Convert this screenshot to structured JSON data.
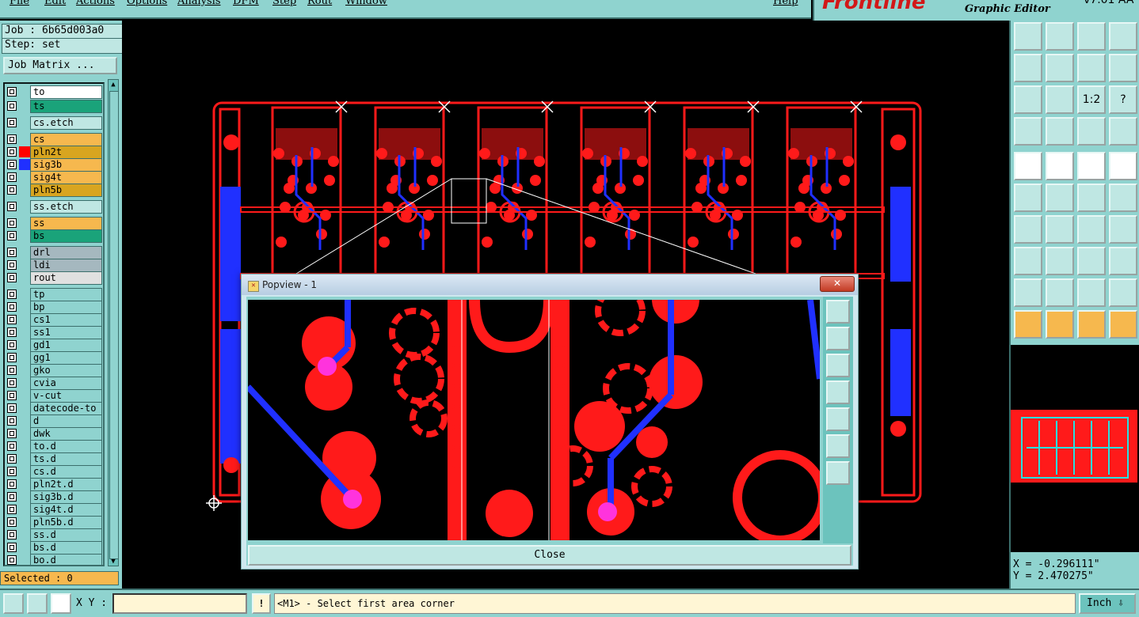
{
  "menubar": {
    "items": [
      "File",
      "Edit",
      "Actions",
      "Options",
      "Analysis",
      "DFM",
      "Step",
      "Rout",
      "Window"
    ],
    "help": "Help"
  },
  "brand": {
    "logo": "Frontline",
    "subtitle": "Graphic Editor",
    "version": "v7.01 AA"
  },
  "job": {
    "job_line": "Job : 6b65d003a0",
    "step_line": "Step: set",
    "matrix_button": "Job Matrix ..."
  },
  "layers": [
    {
      "name": "to",
      "color": "#ffffff",
      "swatch": ""
    },
    {
      "name": "ts",
      "color": "#1aa37a",
      "swatch": ""
    },
    {
      "name": "cs.etch",
      "color": "#bfe7e3",
      "swatch": ""
    },
    {
      "name": "cs",
      "color": "#f6b84e",
      "swatch": ""
    },
    {
      "name": "pln2t",
      "color": "#d8a520",
      "swatch": "#ff0000"
    },
    {
      "name": "sig3b",
      "color": "#f6b84e",
      "swatch": "#2030ff"
    },
    {
      "name": "sig4t",
      "color": "#f6b84e",
      "swatch": ""
    },
    {
      "name": "pln5b",
      "color": "#d8a520",
      "swatch": ""
    },
    {
      "name": "ss.etch",
      "color": "#bfe7e3",
      "swatch": ""
    },
    {
      "name": "ss",
      "color": "#f6b84e",
      "swatch": ""
    },
    {
      "name": "bs",
      "color": "#1aa37a",
      "swatch": ""
    },
    {
      "name": "drl",
      "color": "#a5b8bf",
      "swatch": ""
    },
    {
      "name": "ldi",
      "color": "#a5b8bf",
      "swatch": ""
    },
    {
      "name": "rout",
      "color": "#e0e0e0",
      "swatch": ""
    },
    {
      "name": "tp",
      "color": "#8fd3cf",
      "swatch": ""
    },
    {
      "name": "bp",
      "color": "#8fd3cf",
      "swatch": ""
    },
    {
      "name": "cs1",
      "color": "#8fd3cf",
      "swatch": ""
    },
    {
      "name": "ss1",
      "color": "#8fd3cf",
      "swatch": ""
    },
    {
      "name": "gd1",
      "color": "#8fd3cf",
      "swatch": ""
    },
    {
      "name": "gg1",
      "color": "#8fd3cf",
      "swatch": ""
    },
    {
      "name": "gko",
      "color": "#8fd3cf",
      "swatch": ""
    },
    {
      "name": "cvia",
      "color": "#8fd3cf",
      "swatch": ""
    },
    {
      "name": "v-cut",
      "color": "#8fd3cf",
      "swatch": ""
    },
    {
      "name": "datecode-to",
      "color": "#8fd3cf",
      "swatch": ""
    },
    {
      "name": "d",
      "color": "#8fd3cf",
      "swatch": ""
    },
    {
      "name": "dwk",
      "color": "#8fd3cf",
      "swatch": ""
    },
    {
      "name": "to.d",
      "color": "#8fd3cf",
      "swatch": ""
    },
    {
      "name": "ts.d",
      "color": "#8fd3cf",
      "swatch": ""
    },
    {
      "name": "cs.d",
      "color": "#8fd3cf",
      "swatch": ""
    },
    {
      "name": "pln2t.d",
      "color": "#8fd3cf",
      "swatch": ""
    },
    {
      "name": "sig3b.d",
      "color": "#8fd3cf",
      "swatch": ""
    },
    {
      "name": "sig4t.d",
      "color": "#8fd3cf",
      "swatch": ""
    },
    {
      "name": "pln5b.d",
      "color": "#8fd3cf",
      "swatch": ""
    },
    {
      "name": "ss.d",
      "color": "#8fd3cf",
      "swatch": ""
    },
    {
      "name": "bs.d",
      "color": "#8fd3cf",
      "swatch": ""
    },
    {
      "name": "bo.d",
      "color": "#8fd3cf",
      "swatch": ""
    }
  ],
  "status": {
    "selected": "Selected : 0"
  },
  "coords": {
    "x": "X = -0.296111\"",
    "y": "Y = 2.470275\""
  },
  "bottom": {
    "xy_label": "X Y :",
    "xy_value": "",
    "prompt": "<M1> - Select first area corner",
    "units": "Inch",
    "excl": "!"
  },
  "popview": {
    "title": "Popview - 1",
    "close_x": "✕",
    "close_button": "Close"
  },
  "toolbar_labels": {
    "ratio": "1:2",
    "help": "?"
  },
  "colors": {
    "panel": "#8fd3cf",
    "copper": "#ff0000",
    "signal": "#2030ff",
    "via": "#ff33dd"
  }
}
